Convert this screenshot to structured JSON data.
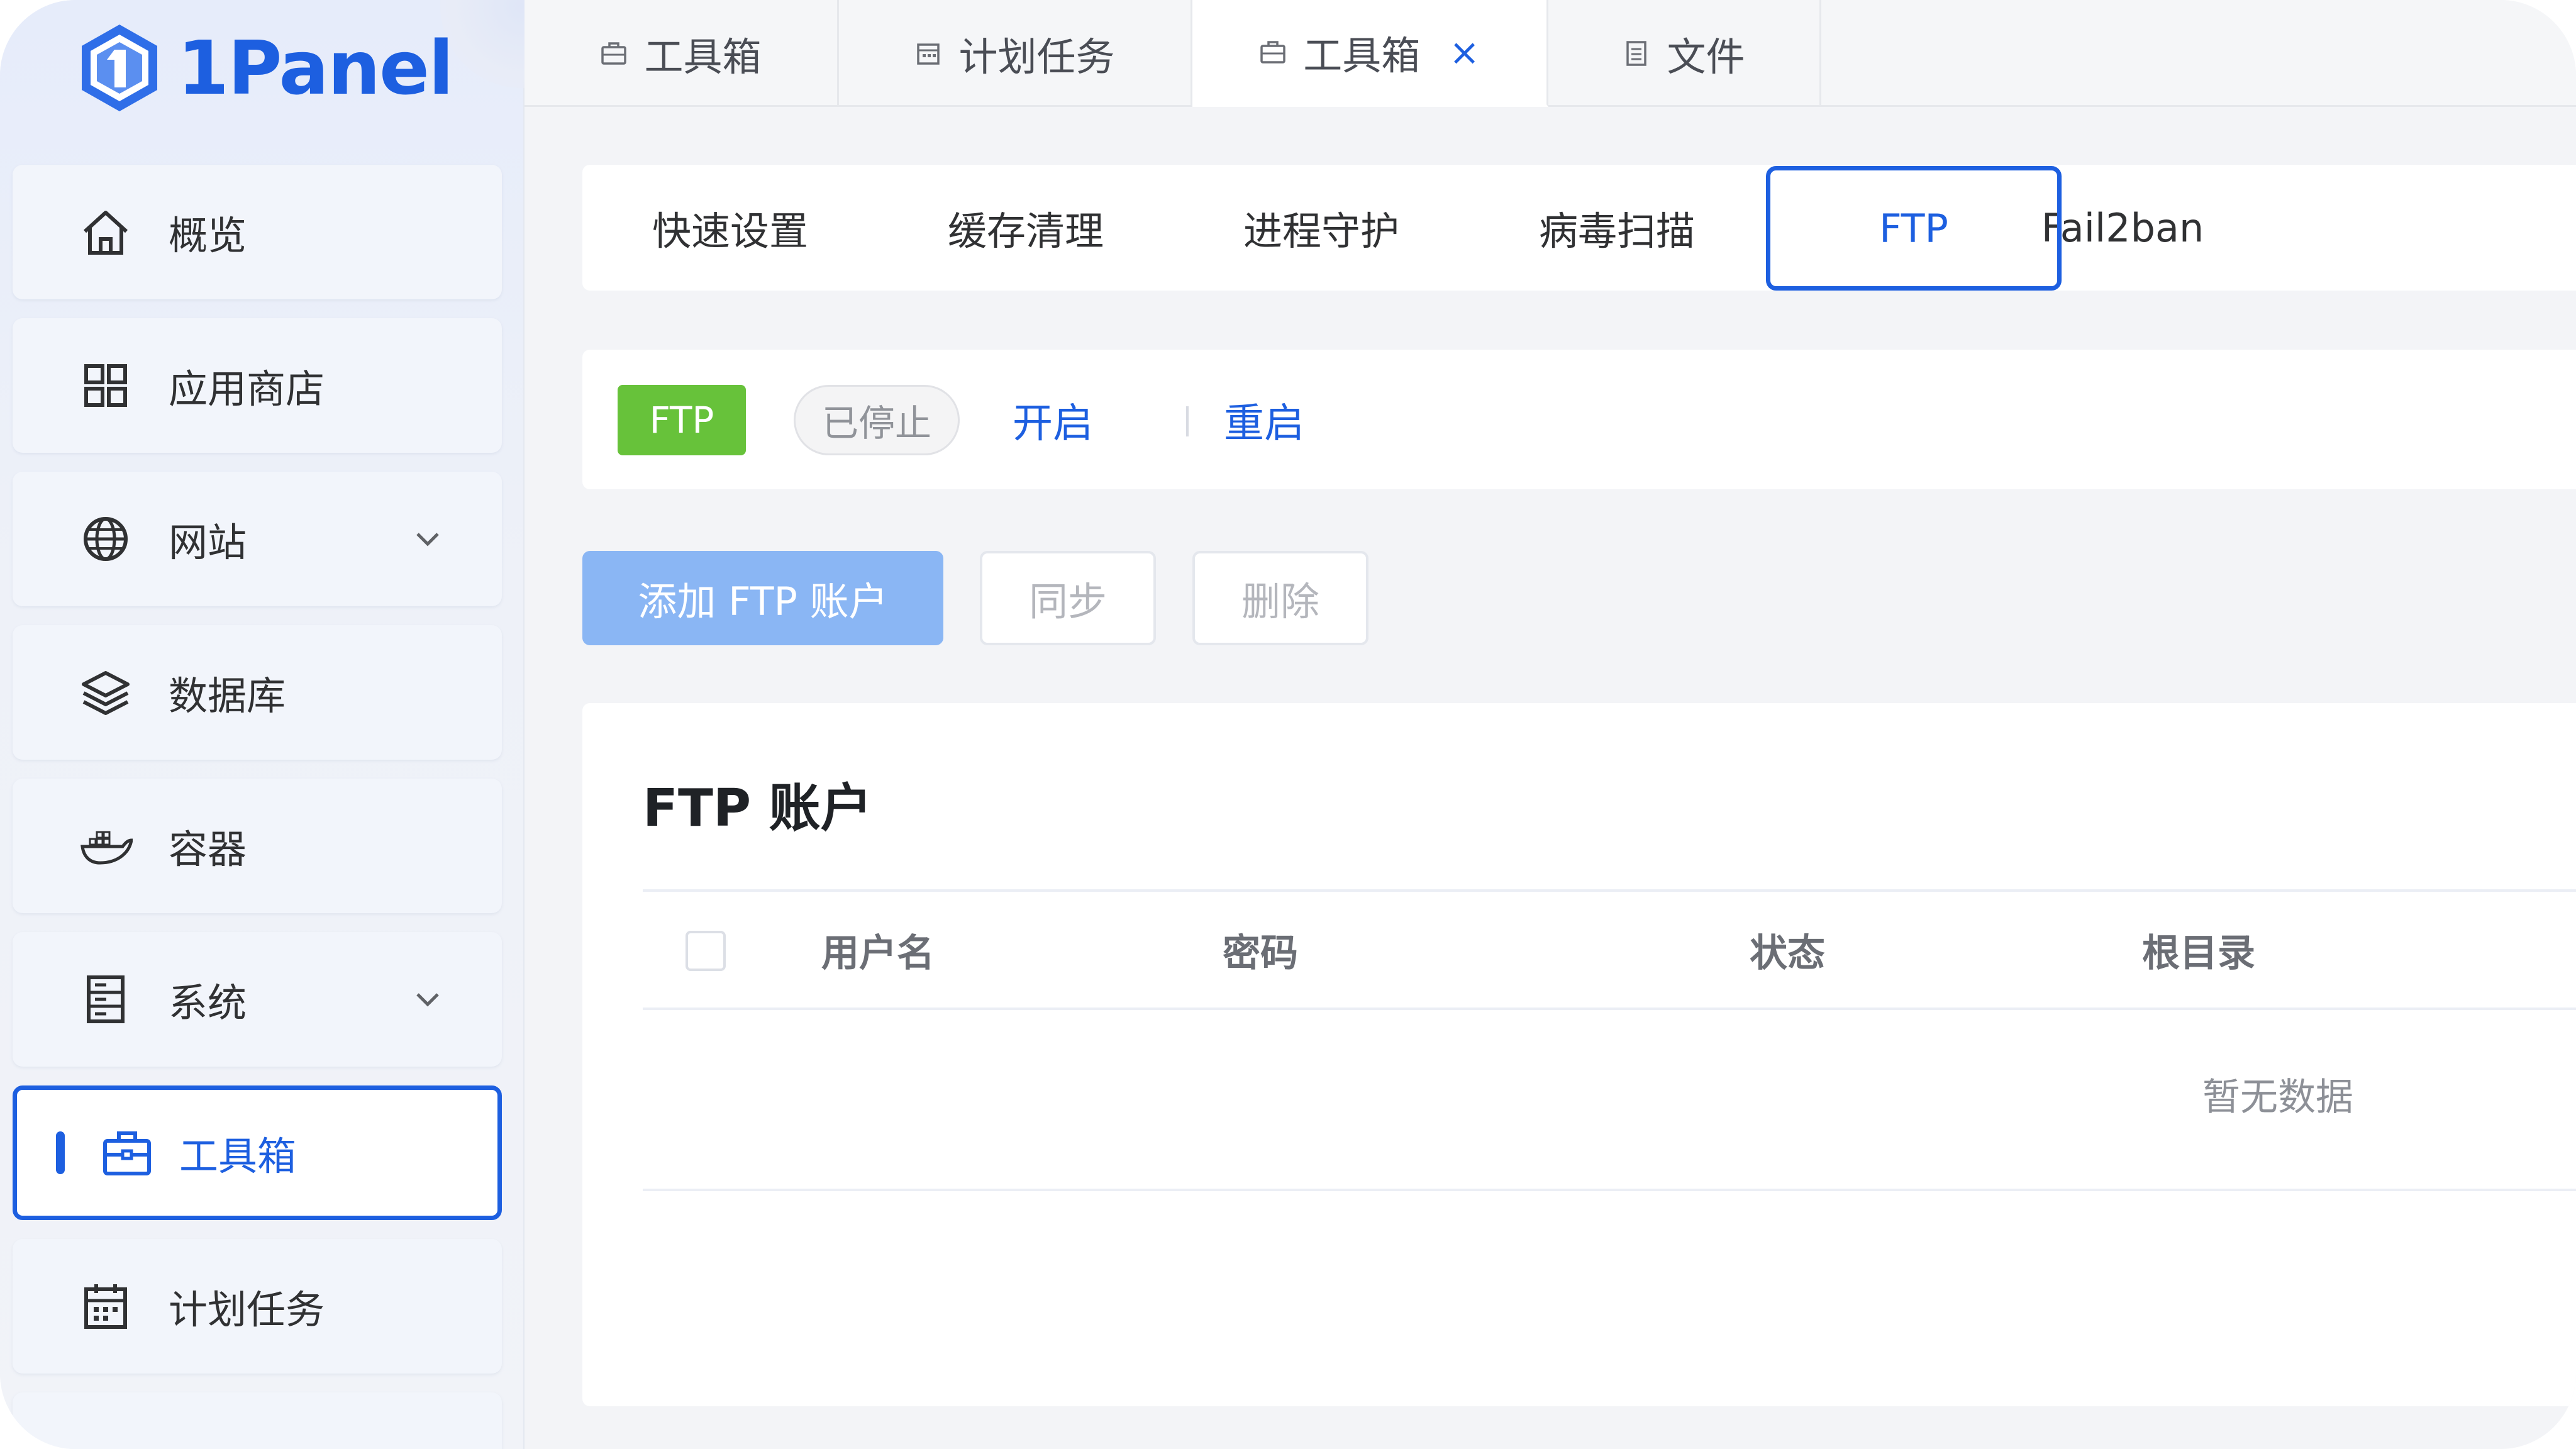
{
  "app": {
    "name": "1Panel"
  },
  "sidebar": {
    "items": [
      {
        "label": "概览",
        "icon": "home-icon",
        "has_chevron": false,
        "active": false
      },
      {
        "label": "应用商店",
        "icon": "app-grid-icon",
        "has_chevron": false,
        "active": false
      },
      {
        "label": "网站",
        "icon": "globe-icon",
        "has_chevron": true,
        "active": false
      },
      {
        "label": "数据库",
        "icon": "database-layers-icon",
        "has_chevron": false,
        "active": false
      },
      {
        "label": "容器",
        "icon": "docker-whale-icon",
        "has_chevron": false,
        "active": false
      },
      {
        "label": "系统",
        "icon": "server-icon",
        "has_chevron": true,
        "active": false
      },
      {
        "label": "工具箱",
        "icon": "toolbox-icon",
        "has_chevron": false,
        "active": true
      },
      {
        "label": "计划任务",
        "icon": "calendar-icon",
        "has_chevron": false,
        "active": false
      }
    ]
  },
  "tabs": [
    {
      "label": "工具箱",
      "icon": "toolbox-icon",
      "active": false,
      "closable": false
    },
    {
      "label": "计划任务",
      "icon": "calendar-icon",
      "active": false,
      "closable": false
    },
    {
      "label": "工具箱",
      "icon": "toolbox-icon",
      "active": true,
      "closable": true,
      "close_glyph": "×"
    },
    {
      "label": "文件",
      "icon": "file-icon",
      "active": false,
      "closable": false
    }
  ],
  "toolbox_tabs": [
    {
      "label": "快速设置",
      "active": false
    },
    {
      "label": "缓存清理",
      "active": false
    },
    {
      "label": "进程守护",
      "active": false
    },
    {
      "label": "病毒扫描",
      "active": false
    },
    {
      "label": "FTP",
      "active": true
    },
    {
      "label": "Fail2ban",
      "active": false
    }
  ],
  "status": {
    "service_badge": "FTP",
    "state_badge": "已停止",
    "start_link": "开启",
    "restart_link": "重启"
  },
  "actions": {
    "add_label": "添加 FTP 账户",
    "sync_label": "同步",
    "delete_label": "删除"
  },
  "table": {
    "title": "FTP 账户",
    "columns": [
      "用户名",
      "密码",
      "状态",
      "根目录"
    ],
    "rows": [],
    "empty_text": "暂无数据"
  },
  "colors": {
    "accent": "#1d5fe0",
    "success": "#67c23a",
    "primary_disabled": "#8ab6f4",
    "muted_text": "#909399"
  }
}
